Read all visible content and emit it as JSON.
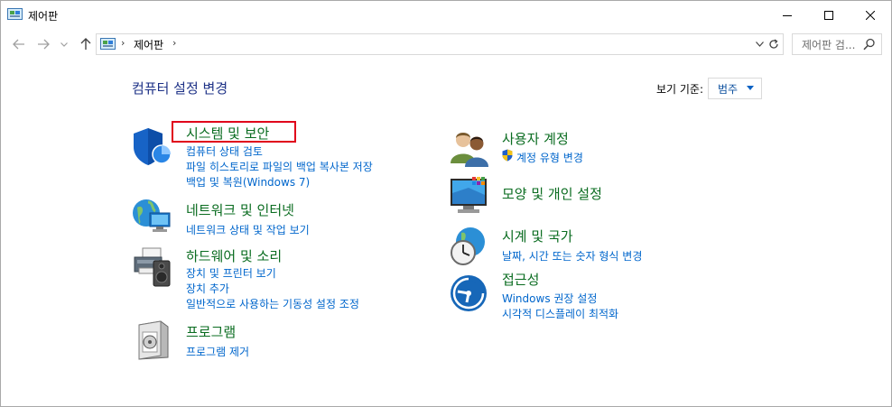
{
  "window": {
    "title": "제어판"
  },
  "address": {
    "path": "제어판",
    "separator": "›",
    "search_placeholder": "제어판 검..."
  },
  "main": {
    "heading": "컴퓨터 설정 변경",
    "view_by_label": "보기 기준:",
    "view_by_value": "범주"
  },
  "categories_left": [
    {
      "title": "시스템 및 보안",
      "links": [
        "컴퓨터 상태 검토",
        "파일 히스토리로 파일의 백업 복사본 저장",
        "백업 및 복원(Windows 7)"
      ]
    },
    {
      "title": "네트워크 및 인터넷",
      "links": [
        "네트워크 상태 및 작업 보기"
      ]
    },
    {
      "title": "하드웨어 및 소리",
      "links": [
        "장치 및 프린터 보기",
        "장치 추가",
        "일반적으로 사용하는 기동성 설정 조정"
      ]
    },
    {
      "title": "프로그램",
      "links": [
        "프로그램 제거"
      ]
    }
  ],
  "categories_right": [
    {
      "title": "사용자 계정",
      "links": [
        "계정 유형 변경"
      ]
    },
    {
      "title": "모양 및 개인 설정",
      "links": []
    },
    {
      "title": "시계 및 국가",
      "links": [
        "날짜, 시간 또는 숫자 형식 변경"
      ]
    },
    {
      "title": "접근성",
      "links": [
        "Windows 권장 설정",
        "시각적 디스플레이 최적화"
      ]
    }
  ],
  "colors": {
    "title_green": "#0a6c20",
    "link_blue": "#0066cc",
    "heading_blue": "#1e3287",
    "highlight_red": "#e0001b"
  }
}
